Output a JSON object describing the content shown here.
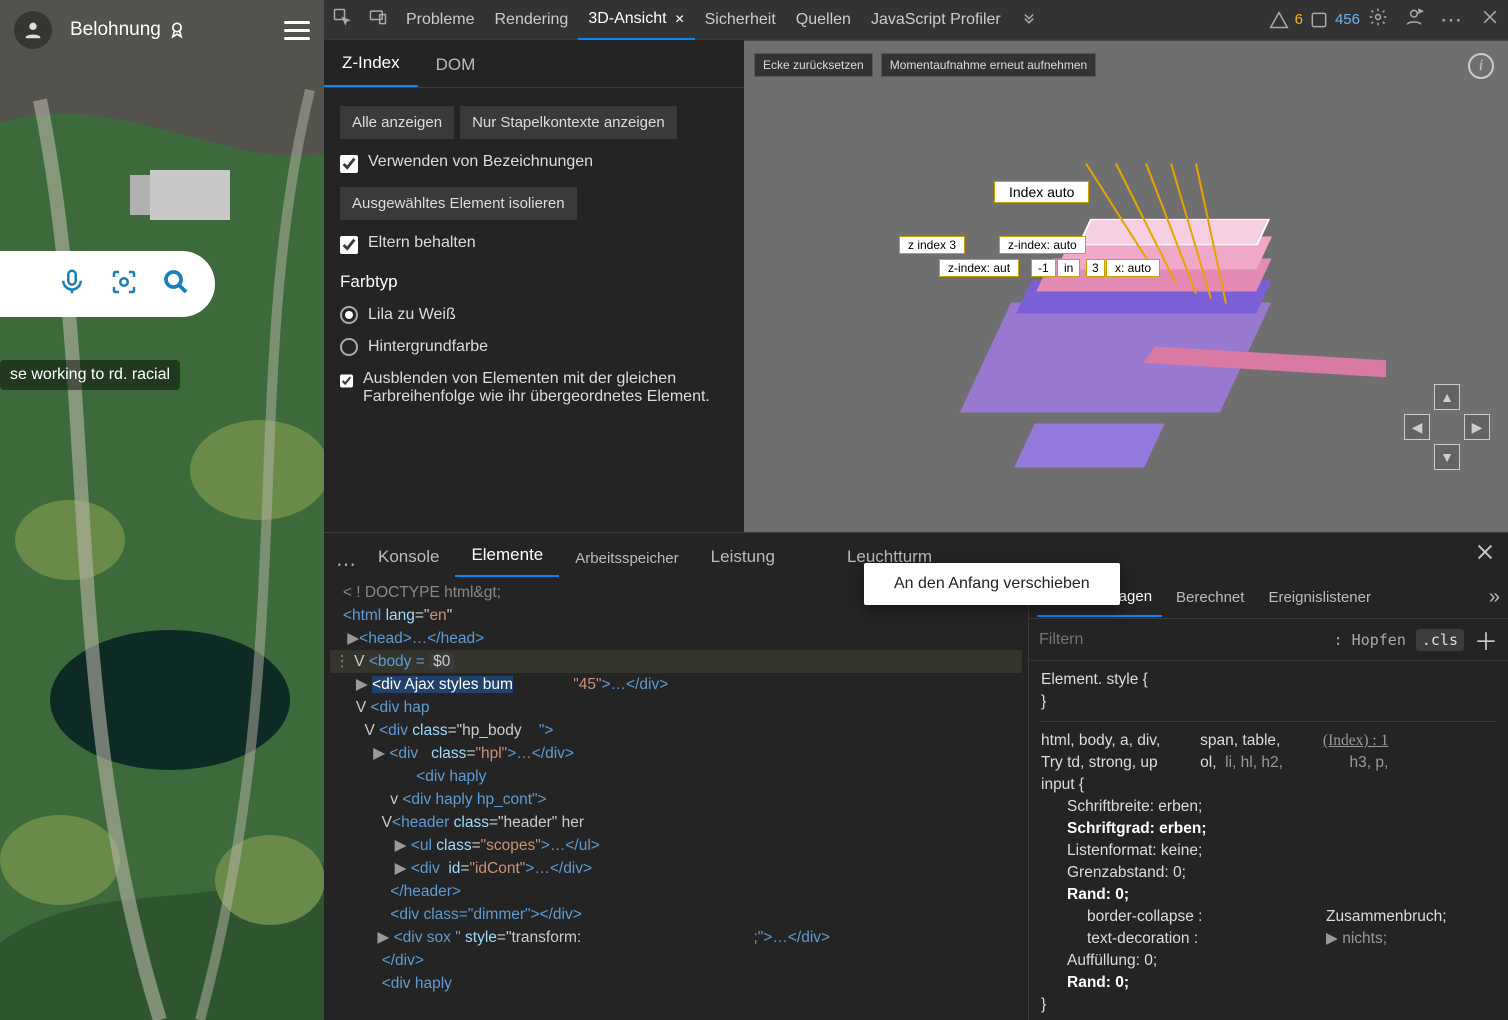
{
  "leftBrowser": {
    "rewardLabel": "Belohnung",
    "headline": "se working to rd. racial"
  },
  "devtoolsTop": {
    "tools": [
      "Probleme",
      "Rendering",
      "3D-Ansicht",
      "Sicherheit",
      "Quellen",
      "JavaScript Profiler"
    ],
    "activeTool": "3D-Ansicht",
    "warnCount": "6",
    "errCount": "456"
  },
  "zIndexPanel": {
    "tabs": [
      "Z-Index",
      "DOM"
    ],
    "showAll": "Alle anzeigen",
    "onlyStacking": "Nur Stapelkontexte anzeigen",
    "useLabels": "Verwenden von Bezeichnungen",
    "isolate": "Ausgewähltes Element isolieren",
    "keepParents": "Eltern behalten",
    "colorTypeTitle": "Farbtyp",
    "colorOpt1": "Lila zu Weiß",
    "colorOpt2": "Hintergrundfarbe",
    "hideSame": "Ausblenden von Elementen mit der gleichen Farbreihenfolge wie ihr übergeordnetes Element."
  },
  "viewport": {
    "resetCorner": "Ecke zurücksetzen",
    "retake": "Momentaufnahme erneut aufnehmen",
    "labels": {
      "indexAuto": "Index auto",
      "z3": "z index 3",
      "zauto1": "z-index: auto",
      "zauto2": "z-index: aut",
      "m1": "-1",
      "in": "in",
      "x3": "3",
      "xauto": "x: auto"
    }
  },
  "drawer": {
    "tabs": [
      "Konsole",
      "Elemente",
      "Arbeitsspeicher",
      "Leistung",
      "Leuchtturm"
    ],
    "activeTab": "Elemente",
    "contextMenuItem": "An den Anfang verschieben",
    "dom": {
      "l1": "< ! DOCTYPE html&gt;",
      "l2a": "<html ",
      "l2b": "lang",
      "l2c": "=\"",
      "l2d": "en",
      "l2e": "\" ",
      "l3": "<head>…</head>",
      "l4a": "<body ­­= ",
      "l4b": "$0",
      "l5a": "<div Ajax styles bum",
      "l5b": "\"45\"",
      "l5c": ">…</div>",
      "l6": "<div hap",
      "l7a": "<div ",
      "l7b": "class",
      "l7c": "=\"hp_body",
      "l7d": "    \">",
      "l8a": "<div   ",
      "l8b": "class",
      "l8c": "=",
      "l8d": "\"hpl\"",
      "l8e": ">…</div>",
      "l9": "<div haply",
      "l10": "<div haply hp_cont\">",
      "l11a": "<header ",
      "l11b": "class",
      "l11c": "=\"header\" her",
      "l12a": "<ul ",
      "l12b": "class",
      "l12c": "=",
      "l12d": "\"scopes\"",
      "l12e": ">…</ul>",
      "l13a": "<div  ",
      "l13b": "id",
      "l13c": "=",
      "l13d": "\"idCont\"",
      "l13e": ">…</div>",
      "l14": "</header>",
      "l15": "<div class=\"dimmer\"></div>",
      "l16a": "<div sox \" ",
      "l16b": "style",
      "l16c": "=\"transform:",
      "l16d": ";\">…</div>",
      "l17": "</div>",
      "l18": "<div haply"
    }
  },
  "stylesPane": {
    "tabs": [
      "Formatvorlagen",
      "Berechnet",
      "Ereignislistener"
    ],
    "filterPlaceholder": "Filtern",
    "hov": ": Hopfen",
    "cls": ".cls",
    "elementStyleOpen": "Element. style {",
    "brace": "}",
    "selectorLine1": "html, body, a, div,",
    "selectorLine2": "Try td, strong, up",
    "selectorLine3": "input {",
    "mid1": "span, table,",
    "mid2": "ol,",
    "mid2b": "li, hl, h2,",
    "src1": "(Index) : 1",
    "src2": "h3, p,",
    "p_fontwidth": "Schriftbreite: erben;",
    "p_fontsize": "Schriftgrad: erben;",
    "p_listformat": "Listenformat: keine;",
    "p_gap": "Grenzabstand: 0;",
    "p_margin": "Rand: 0;",
    "p_bordercollapse": "border-collapse :",
    "p_textdeco": "text-decoration :",
    "p_bc_val": "Zusammenbruch;",
    "p_td_val": "nichts;",
    "p_padding": "Auffüllung: 0;",
    "p_border": "Rand: 0;"
  }
}
